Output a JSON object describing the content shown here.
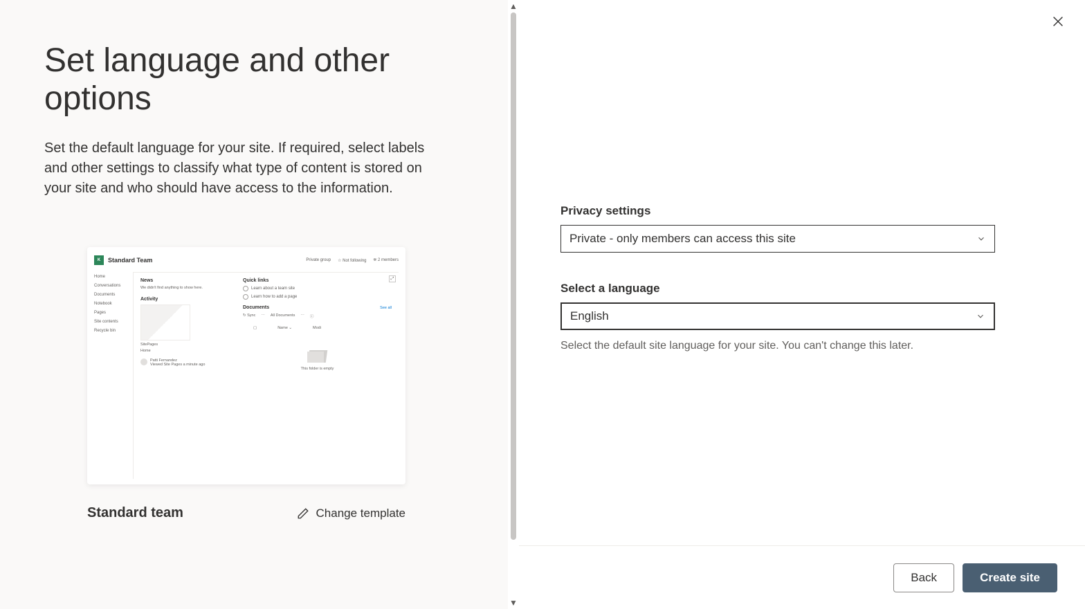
{
  "left": {
    "title": "Set language and other options",
    "description": "Set the default language for your site. If required, select labels and other settings to classify what type of content is stored on your site and who should have access to the information.",
    "template_name": "Standard team",
    "change_template_label": "Change template"
  },
  "preview": {
    "logo_letter": "K",
    "site_name": "Standard Team",
    "header_items": [
      "Private group",
      "☆ Not following",
      "⛯ 2 members"
    ],
    "nav": [
      "Home",
      "Conversations",
      "Documents",
      "Notebook",
      "Pages",
      "Site contents",
      "Recycle bin"
    ],
    "news_title": "News",
    "news_empty": "We didn't find anything to show here.",
    "activity_title": "Activity",
    "activity_item": "SitePages",
    "activity_sub": "Home",
    "person_name": "Patti Fernandez",
    "person_meta": "Viewed Site Pages a minute ago",
    "quicklinks_title": "Quick links",
    "links": [
      "Learn about a team site",
      "Learn how to add a page"
    ],
    "documents_title": "Documents",
    "see_all": "See all",
    "toolbar": [
      "↻ Sync",
      "⋯",
      "All Documents",
      "⋯",
      "ⓘ"
    ],
    "table_head": [
      "▢",
      "Name ⌄",
      "Modi"
    ],
    "empty_text": "This folder is empty"
  },
  "form": {
    "privacy_label": "Privacy settings",
    "privacy_value": "Private - only members can access this site",
    "language_label": "Select a language",
    "language_value": "English",
    "language_helper": "Select the default site language for your site. You can't change this later."
  },
  "footer": {
    "back": "Back",
    "create": "Create site"
  }
}
